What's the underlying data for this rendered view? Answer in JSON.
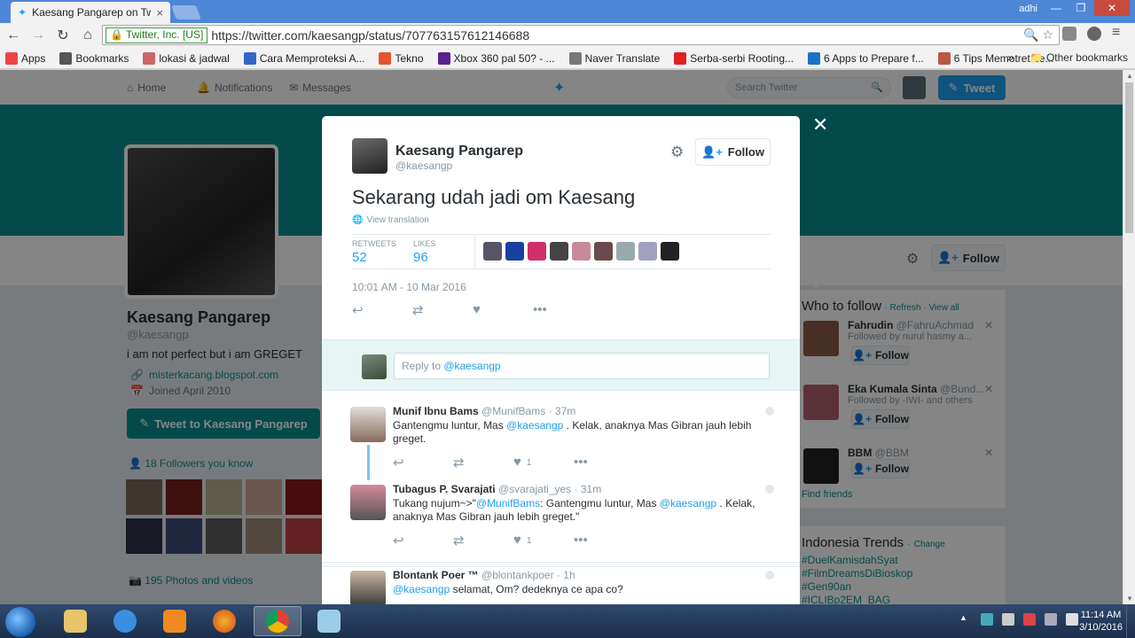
{
  "browser": {
    "tab_title": "Kaesang Pangarep on Twit",
    "user": "adhi",
    "ev_label": "Twitter, Inc. [US]",
    "url": "https://twitter.com/kaesangp/status/707763157612146688",
    "bookmarks": [
      {
        "icon": "apps-grid-icon",
        "label": "Apps",
        "color": "#e44"
      },
      {
        "icon": "star-icon",
        "label": "Bookmarks",
        "color": "#555"
      },
      {
        "icon": "leaf-icon",
        "label": "lokasi & jadwal",
        "color": "#c66"
      },
      {
        "icon": "go-icon",
        "label": "Cara Memproteksi A...",
        "color": "#36c"
      },
      {
        "icon": "flame-icon",
        "label": "Tekno",
        "color": "#e5562a"
      },
      {
        "icon": "yahoo-icon",
        "label": "Xbox 360 pal 50? - ...",
        "color": "#5b1f8f"
      },
      {
        "icon": "page-icon",
        "label": "Naver Translate",
        "color": "#777"
      },
      {
        "icon": "s-icon",
        "label": "Serba-serbi Rooting...",
        "color": "#d22"
      },
      {
        "icon": "m-icon",
        "label": "6 Apps to Prepare f...",
        "color": "#1a73c9"
      },
      {
        "icon": "mail-icon",
        "label": "6 Tips Memotret de...",
        "color": "#b54"
      }
    ],
    "other_bookmarks": "Other bookmarks",
    "more": "»"
  },
  "topnav": {
    "home": "Home",
    "notifications": "Notifications",
    "messages": "Messages",
    "search_placeholder": "Search Twitter",
    "tweet": "Tweet"
  },
  "profile": {
    "name": "Kaesang Pangarep",
    "handle": "@kaesangp",
    "bio": "i am not perfect but i am GREGET",
    "link": "misterkacang.blogspot.com",
    "joined": "Joined April 2010",
    "tweet_to": "Tweet to Kaesang Pangarep",
    "followers_you_know": "18 Followers you know",
    "photos": "195 Photos and videos",
    "follow": "Follow"
  },
  "who_to_follow": {
    "title": "Who to follow",
    "refresh": "Refresh",
    "view_all": "View all",
    "sep": "·",
    "items": [
      {
        "name": "Fahrudin",
        "handle": "@FahruAchmad",
        "sub": "Followed by nurul hasmy a...",
        "follow": "Follow"
      },
      {
        "name": "Eka Kumala Sinta",
        "handle": "@Bund...",
        "sub": "Followed by -IWI- and others",
        "follow": "Follow"
      },
      {
        "name": "BBM",
        "handle": "@BBM",
        "sub": "",
        "follow": "Follow"
      }
    ],
    "find_friends": "Find friends"
  },
  "trends": {
    "title": "Indonesia Trends",
    "change": "Change",
    "items": [
      "#DuelKamisdahSyat",
      "#FilmDreamsDiBioskop",
      "#Gen90an",
      "#ICLIBp2EM_BAG"
    ]
  },
  "tweet": {
    "name": "Kaesang Pangarep",
    "handle": "@kaesangp",
    "follow": "Follow",
    "text": "Sekarang udah jadi om Kaesang",
    "view_translation": "View translation",
    "retweets_label": "RETWEETS",
    "retweets": "52",
    "likes_label": "LIKES",
    "likes": "96",
    "time": "10:01 AM - 10 Mar 2016",
    "reply_prompt": "Reply to ",
    "reply_handle": "@kaesangp"
  },
  "replies": [
    {
      "name": "Munif Ibnu Bams",
      "handle": "@MunifBams",
      "time": "· 37m",
      "body_pre": "Gantengmu luntur, Mas ",
      "mention": "@kaesangp",
      "body_post": " . Kelak, anaknya Mas Gibran jauh lebih greget.",
      "likes": "1"
    },
    {
      "name": "Tubagus P. Svarajati",
      "handle": "@svarajati_yes",
      "time": "· 31m",
      "body_pre": "Tukang nujum~>\"",
      "mention": "@MunifBams",
      "body_mid": ": Gantengmu luntur, Mas ",
      "mention2": "@kaesangp",
      "body_post": " . Kelak, anaknya Mas Gibran jauh lebih greget.\"",
      "likes": "1"
    },
    {
      "name": "Blontank Poer ™",
      "handle": "@blontankpoer",
      "time": "· 1h",
      "mention": "@kaesangp",
      "body_post": " selamat, Om? dedeknya ce apa co?"
    }
  ],
  "taskbar": {
    "time": "11:14 AM",
    "date": "3/10/2016"
  },
  "colors": {
    "accent": "#1da1f2",
    "profile_theme": "#0a8f8f"
  }
}
